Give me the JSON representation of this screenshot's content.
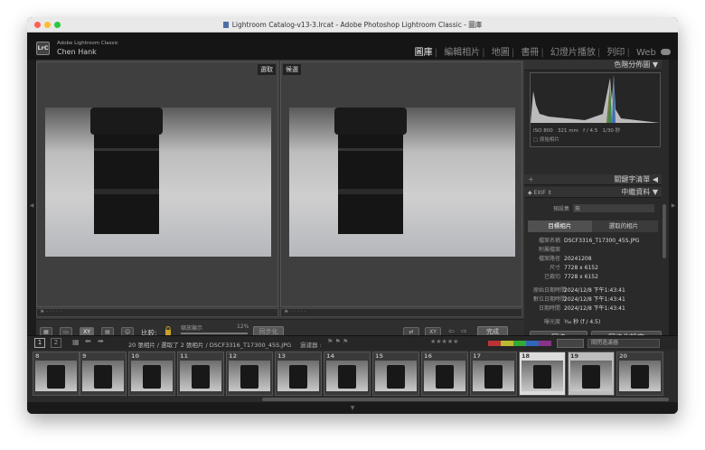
{
  "window": {
    "title": "Lightroom Catalog-v13-3.lrcat - Adobe Photoshop Lightroom Classic - 圖庫"
  },
  "identity": {
    "product": "Adobe Lightroom Classic",
    "user": "Chen Hank"
  },
  "modules": [
    "圖庫",
    "編輯相片",
    "地圖",
    "書冊",
    "幻燈片播放",
    "列印",
    "Web"
  ],
  "compare": {
    "select_label": "選取",
    "candidate_label": "候選"
  },
  "toolbar": {
    "compare_label": "比較:",
    "zoom_label": "縮放顯示",
    "zoom_value": "12%",
    "sync_label": "同步化",
    "done_label": "完成"
  },
  "histogram": {
    "title": "色階分佈圖",
    "iso": "ISO 800",
    "focal": "321 mm",
    "aperture": "f / 4.5",
    "shutter": "1/30 秒",
    "original": "原始相片"
  },
  "keywords": {
    "title": "關鍵字清單"
  },
  "metadata": {
    "title": "中繼資料",
    "preset_dropdown": "EXIF",
    "preset_label": "預設集",
    "preset_value": "無",
    "tab_target": "目標相片",
    "tab_selected": "選取的相片",
    "fields": [
      {
        "k": "檔案名稱",
        "v": "DSCF3316_T17300_45S.JPG"
      },
      {
        "k": "附屬檔案",
        "v": ""
      },
      {
        "k": "檔案路徑",
        "v": "20241208"
      },
      {
        "k": "尺寸",
        "v": "7728 x 6152"
      },
      {
        "k": "已裁切",
        "v": "7728 x 6152"
      },
      {
        "k": "原始日期時間",
        "v": "2024/12/8 下午1:43:41"
      },
      {
        "k": "數位日期時間",
        "v": "2024/12/8 下午1:43:41"
      },
      {
        "k": "日期時間",
        "v": "2024/12/8 下午1:43:41"
      },
      {
        "k": "曝光度",
        "v": "¹⁄₃₀ 秒 (f / 4.5)"
      }
    ]
  },
  "sync_buttons": {
    "sync": "同步",
    "sync_settings": "同步化設定"
  },
  "filmstrip_bar": {
    "view1": "1",
    "view2": "2",
    "path": "20 張相片 / 選取了 2 張相片 / DSCF3316_T17300_45S.JPG",
    "filter_label": "過濾器 :",
    "filter_value": "關閉過濾器"
  },
  "filmstrip": [
    {
      "n": "8"
    },
    {
      "n": "9"
    },
    {
      "n": "10"
    },
    {
      "n": "11"
    },
    {
      "n": "12"
    },
    {
      "n": "13"
    },
    {
      "n": "14"
    },
    {
      "n": "15"
    },
    {
      "n": "16"
    },
    {
      "n": "17"
    },
    {
      "n": "18"
    },
    {
      "n": "19"
    },
    {
      "n": "20"
    }
  ]
}
